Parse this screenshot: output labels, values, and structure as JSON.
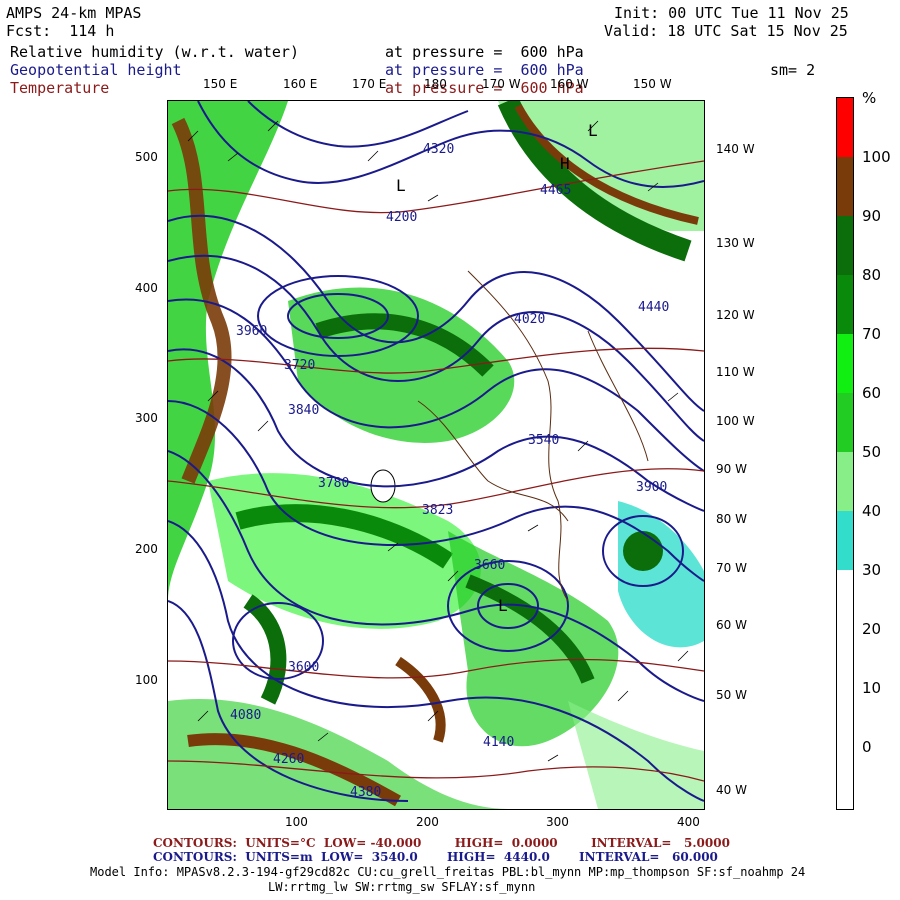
{
  "header": {
    "model": "AMPS 24-km MPAS",
    "fcst": "Fcst:  114 h",
    "init": "Init: 00 UTC Tue 11 Nov 25",
    "valid": "Valid: 18 UTC Sat 15 Nov 25",
    "fields": [
      {
        "name": "Relative humidity (w.r.t. water)",
        "level": "at pressure =  600 hPa",
        "color": "#000000"
      },
      {
        "name": "Geopotential height",
        "level": "at pressure =  600 hPa",
        "color": "#1a1a8c"
      },
      {
        "name": "Temperature",
        "level": "at pressure =  600 hPa",
        "color": "#8b1a1a"
      }
    ],
    "smoothing": "sm= 2"
  },
  "axes": {
    "top_ticks": [
      "150 E",
      "160 E",
      "170 E",
      "180",
      "170 W",
      "160 W",
      "150 W"
    ],
    "right_ticks": [
      "140 W",
      "130 W",
      "120 W",
      "110 W",
      "100 W",
      "90 W",
      "80 W",
      "70 W",
      "60 W",
      "50 W",
      "40 W"
    ],
    "left_ticks": [
      "500",
      "400",
      "300",
      "200",
      "100"
    ],
    "bottom_ticks": [
      "100",
      "200",
      "300",
      "400"
    ]
  },
  "colorbar": {
    "unit": "%",
    "labels": [
      "100",
      "90",
      "80",
      "70",
      "60",
      "50",
      "40",
      "30",
      "20",
      "10",
      "0"
    ],
    "colors": [
      "#ff0000",
      "#7a3b0a",
      "#0b6e0b",
      "#0a8a0a",
      "#11ee11",
      "#22cc22",
      "#88ee88",
      "#33ddcc",
      "#ffffff",
      "#ffffff",
      "#ffffff",
      "#ffffff"
    ]
  },
  "footer": {
    "temp_contours": "CONTOURS:  UNITS=°C  LOW= -40.000        HIGH=  0.0000        INTERVAL=   5.0000",
    "height_contours": "CONTOURS:  UNITS=m  LOW=  3540.0       HIGH=  4440.0       INTERVAL=   60.000",
    "model_info_1": "Model Info: MPASv8.2.3-194-gf29cd82c CU:cu_grell_freitas PBL:bl_mynn MP:mp_thompson SF:sf_noahmp 24",
    "model_info_2": "LW:rrtmg_lw SW:rrtmg_sw SFLAY:sf_mynn"
  },
  "height_labels": [
    "4320",
    "4200",
    "4140",
    "4080",
    "3960",
    "3900",
    "3840",
    "3780",
    "3720",
    "3660",
    "3600",
    "3540",
    "4260",
    "4380",
    "4440",
    "4465",
    "3823",
    "4020"
  ],
  "map_features": {
    "low_centers": [
      "L",
      "L",
      "L"
    ],
    "high_center": "H"
  }
}
